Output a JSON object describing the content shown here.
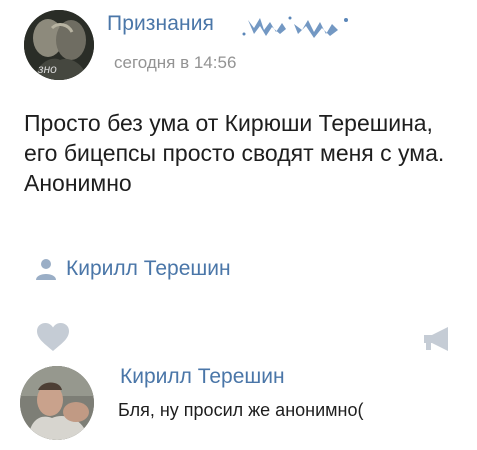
{
  "post": {
    "group_name": "Признания",
    "time": "сегодня в 14:56",
    "avatar_label": "зно",
    "text": "Просто без ума от Кирюши Терешина, его бицепсы просто сводят меня с ума. Анонимно",
    "signer": {
      "icon": "user-icon",
      "name": "Кирилл Терешин"
    }
  },
  "actions": {
    "like_icon": "heart-icon",
    "share_icon": "megaphone-icon"
  },
  "comment": {
    "author": "Кирилл Терешин",
    "text": "Бля, ну просил же анонимно("
  },
  "colors": {
    "link": "#4a76a8",
    "meta": "#939393",
    "icon": "#c5ccd5",
    "text": "#1e1e1e"
  }
}
